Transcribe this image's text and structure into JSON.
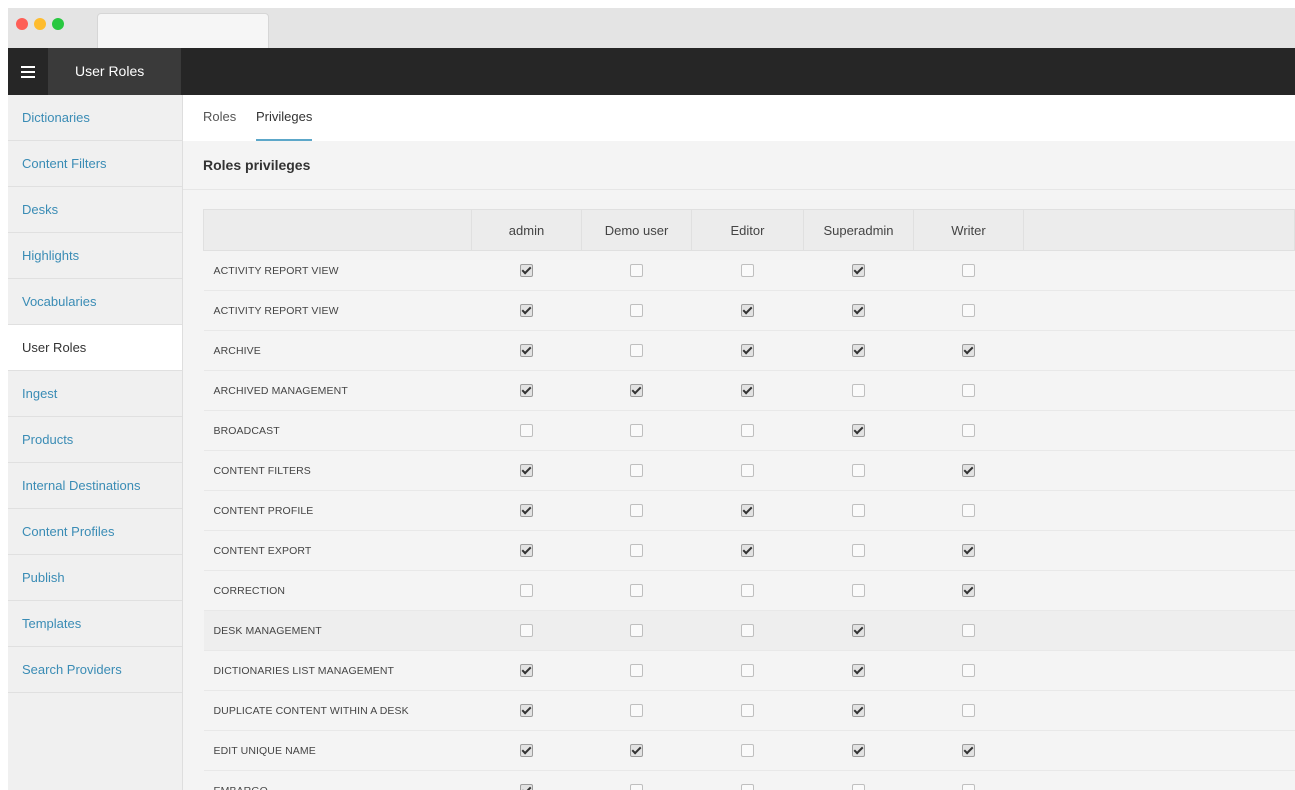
{
  "app": {
    "title": "User Roles"
  },
  "sidebar": {
    "items": [
      {
        "label": "Dictionaries",
        "active": false
      },
      {
        "label": "Content Filters",
        "active": false
      },
      {
        "label": "Desks",
        "active": false
      },
      {
        "label": "Highlights",
        "active": false
      },
      {
        "label": "Vocabularies",
        "active": false
      },
      {
        "label": "User Roles",
        "active": true
      },
      {
        "label": "Ingest",
        "active": false
      },
      {
        "label": "Products",
        "active": false
      },
      {
        "label": "Internal Destinations",
        "active": false
      },
      {
        "label": "Content Profiles",
        "active": false
      },
      {
        "label": "Publish",
        "active": false
      },
      {
        "label": "Templates",
        "active": false
      },
      {
        "label": "Search Providers",
        "active": false
      }
    ]
  },
  "tabs": [
    {
      "label": "Roles",
      "active": false
    },
    {
      "label": "Privileges",
      "active": true
    }
  ],
  "section": {
    "title": "Roles privileges"
  },
  "table": {
    "columns": [
      "admin",
      "Demo user",
      "Editor",
      "Superadmin",
      "Writer"
    ],
    "rows": [
      {
        "name": "ACTIVITY REPORT VIEW",
        "values": [
          true,
          false,
          false,
          true,
          false
        ]
      },
      {
        "name": "ACTIVITY REPORT VIEW",
        "values": [
          true,
          false,
          true,
          true,
          false
        ]
      },
      {
        "name": "ARCHIVE",
        "values": [
          true,
          false,
          true,
          true,
          true
        ]
      },
      {
        "name": "ARCHIVED MANAGEMENT",
        "values": [
          true,
          true,
          true,
          false,
          false
        ]
      },
      {
        "name": "BROADCAST",
        "values": [
          false,
          false,
          false,
          true,
          false
        ]
      },
      {
        "name": "CONTENT FILTERS",
        "values": [
          true,
          false,
          false,
          false,
          true
        ]
      },
      {
        "name": "CONTENT PROFILE",
        "values": [
          true,
          false,
          true,
          false,
          false
        ]
      },
      {
        "name": "CONTENT EXPORT",
        "values": [
          true,
          false,
          true,
          false,
          true
        ]
      },
      {
        "name": "CORRECTION",
        "values": [
          false,
          false,
          false,
          false,
          true
        ]
      },
      {
        "name": "DESK MANAGEMENT",
        "values": [
          false,
          false,
          false,
          true,
          false
        ],
        "highlight": true
      },
      {
        "name": "DICTIONARIES LIST MANAGEMENT",
        "values": [
          true,
          false,
          false,
          true,
          false
        ]
      },
      {
        "name": "DUPLICATE CONTENT WITHIN A DESK",
        "values": [
          true,
          false,
          false,
          true,
          false
        ]
      },
      {
        "name": "EDIT UNIQUE NAME",
        "values": [
          true,
          true,
          false,
          true,
          true
        ]
      },
      {
        "name": "EMBARGO",
        "values": [
          true,
          false,
          false,
          false,
          false
        ]
      }
    ]
  },
  "icons": {
    "menu": "hamburger-menu-icon",
    "check": "checkbox-icon"
  },
  "colors": {
    "accent": "#5ca7c9",
    "link": "#3a8cb5",
    "topbar": "#262626"
  }
}
